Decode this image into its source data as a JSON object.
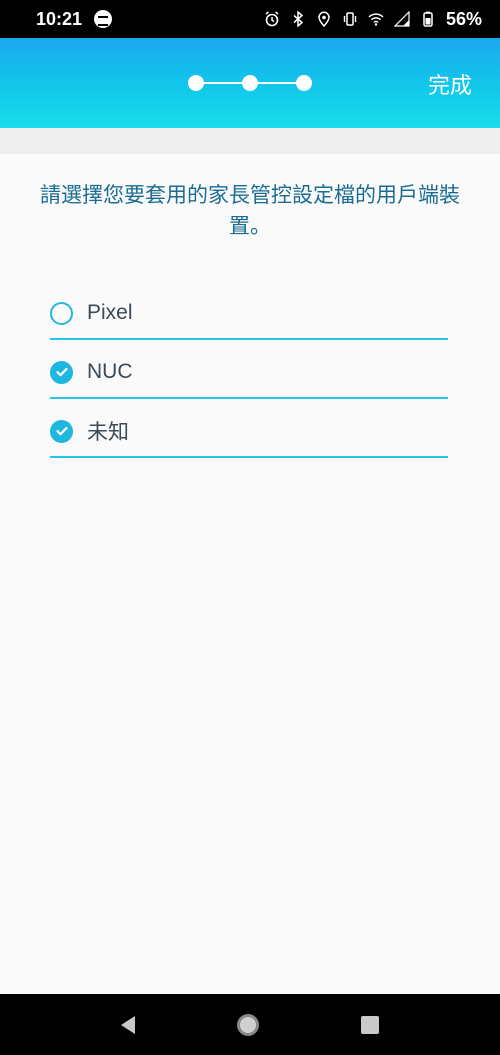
{
  "status_bar": {
    "time": "10:21",
    "battery_percent": "56%",
    "icons": [
      "spotify-icon",
      "alarm-icon",
      "bluetooth-icon",
      "location-icon",
      "vibrate-icon",
      "wifi-icon",
      "signal-icon",
      "battery-icon"
    ]
  },
  "header": {
    "steps_total": 3,
    "current_step": 3,
    "done_label": "完成"
  },
  "main": {
    "prompt": "請選擇您要套用的家長管控設定檔的用戶端裝置。",
    "devices": [
      {
        "label": "Pixel",
        "checked": false
      },
      {
        "label": "NUC",
        "checked": true
      },
      {
        "label": "未知",
        "checked": true
      }
    ]
  },
  "colors": {
    "accent": "#1fb6e0",
    "prompt_text": "#1b6c93",
    "header_top": "#1aa8ef",
    "header_bottom": "#19dceb"
  },
  "nav_bar": {
    "icons": [
      "back-icon",
      "home-icon",
      "recents-icon"
    ]
  }
}
